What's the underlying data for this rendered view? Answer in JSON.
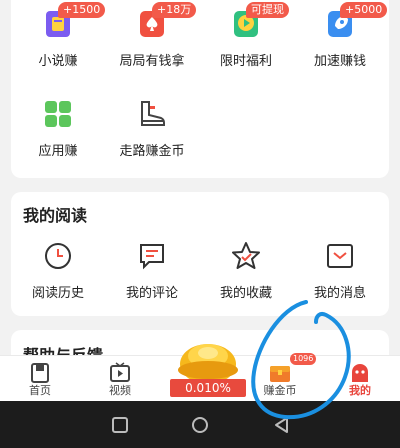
{
  "earn": {
    "items": [
      {
        "label": "小说赚",
        "badge": "+1500",
        "icon": "book-icon"
      },
      {
        "label": "局局有钱拿",
        "badge": "+18万",
        "icon": "poker-icon"
      },
      {
        "label": "限时福利",
        "badge": "可提现",
        "icon": "play-coin-icon"
      },
      {
        "label": "加速赚钱",
        "badge": "+5000",
        "icon": "rocket-icon"
      },
      {
        "label": "应用赚",
        "badge": "",
        "icon": "apps-grid-icon"
      },
      {
        "label": "走路赚金币",
        "badge": "",
        "icon": "shoe-icon"
      }
    ]
  },
  "reading": {
    "title": "我的阅读",
    "items": [
      {
        "label": "阅读历史",
        "icon": "clock-icon"
      },
      {
        "label": "我的评论",
        "icon": "comment-icon"
      },
      {
        "label": "我的收藏",
        "icon": "star-icon"
      },
      {
        "label": "我的消息",
        "icon": "message-icon"
      }
    ]
  },
  "help": {
    "title": "帮助与反馈"
  },
  "tabbar": {
    "tabs": [
      {
        "label": "首页",
        "icon": "home-icon"
      },
      {
        "label": "视频",
        "icon": "video-icon"
      },
      {
        "label": "赚金币",
        "icon": "treasure-chest-icon",
        "badge": "1096"
      },
      {
        "label": "我的",
        "icon": "profile-icon"
      }
    ],
    "center": {
      "percent": "0.010%",
      "icon": "gold-ingot-icon"
    },
    "active_color": "#e8453c"
  },
  "colors": {
    "accent_red": "#f25a4a",
    "annotation_blue": "#1a8fe0"
  }
}
